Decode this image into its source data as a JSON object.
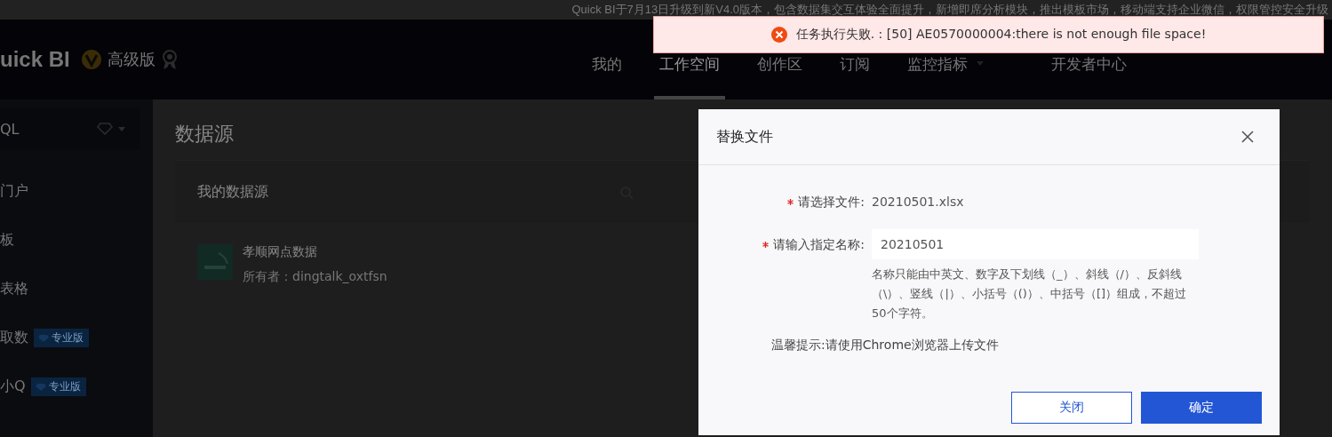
{
  "banner": {
    "text": "Quick BI于7月13日升级到新V4.0版本，包含数据集交互体验全面提升，新增即席分析模块，推出模板市场，移动端支持企业微信，权限管控安全升级"
  },
  "header": {
    "logo": "uick BI",
    "edition": "高级版",
    "nav": [
      {
        "label": "我的",
        "selected": false,
        "dropdown": false
      },
      {
        "label": "工作空间",
        "selected": true,
        "dropdown": false
      },
      {
        "label": "创作区",
        "selected": false,
        "dropdown": false
      },
      {
        "label": "订阅",
        "selected": false,
        "dropdown": false
      },
      {
        "label": "监控指标",
        "selected": false,
        "dropdown": true
      },
      {
        "label": "开发者中心",
        "selected": false,
        "dropdown": false
      }
    ]
  },
  "sidebar": {
    "workspace": "QL",
    "items": [
      {
        "label": "门户"
      },
      {
        "label": "板"
      },
      {
        "label": "表格"
      },
      {
        "label": "取数",
        "badge": "专业版"
      },
      {
        "label": "小Q",
        "badge": "专业版"
      }
    ]
  },
  "main": {
    "title": "数据源",
    "card_title": "我的数据源",
    "sources": [
      {
        "name": "孝顺网点数据",
        "owner": "所有者：dingtalk_oxtfsn"
      }
    ]
  },
  "dialog": {
    "title": "替换文件",
    "fields": [
      {
        "kind": "text",
        "required": true,
        "label": "请选择文件:",
        "value": "20210501.xlsx"
      },
      {
        "kind": "input",
        "required": true,
        "label": "请输入指定名称:",
        "value": "20210501",
        "help": "名称只能由中英文、数字及下划线（_）、斜线（/）、反斜线（\\）、竖线（|）、小括号（()）、中括号（[]）组成，不超过50个字符。"
      }
    ],
    "tip": "温馨提示:请使用Chrome浏览器上传文件",
    "buttons": [
      {
        "kind": "secondary",
        "label": "关闭"
      },
      {
        "kind": "primary",
        "label": "确定"
      }
    ]
  },
  "toast": {
    "message": "任务执行失败. : [50] AE0570000004:there is not enough file space!"
  }
}
